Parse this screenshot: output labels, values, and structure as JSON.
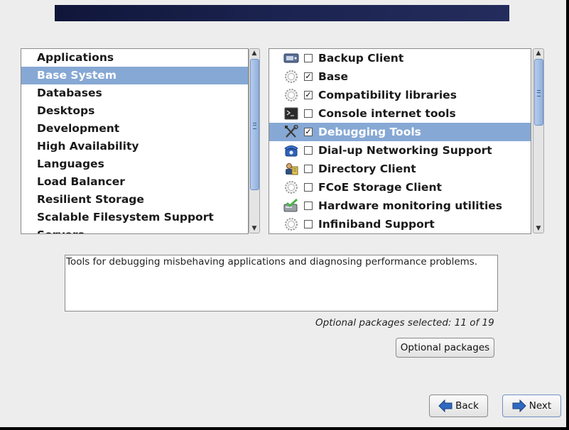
{
  "colors": {
    "banner": "#1b2450",
    "selection": "#86a8d4",
    "page_background": "#ededed"
  },
  "group_list": {
    "items": [
      {
        "label": "Applications",
        "selected": false
      },
      {
        "label": "Base System",
        "selected": true
      },
      {
        "label": "Databases",
        "selected": false
      },
      {
        "label": "Desktops",
        "selected": false
      },
      {
        "label": "Development",
        "selected": false
      },
      {
        "label": "High Availability",
        "selected": false
      },
      {
        "label": "Languages",
        "selected": false
      },
      {
        "label": "Load Balancer",
        "selected": false
      },
      {
        "label": "Resilient Storage",
        "selected": false
      },
      {
        "label": "Scalable Filesystem Support",
        "selected": false
      },
      {
        "label": "Servers",
        "selected": false
      }
    ]
  },
  "package_list": {
    "items": [
      {
        "label": "Backup Client",
        "checked": false,
        "selected": false,
        "icon": "backup-drive-icon"
      },
      {
        "label": "Base",
        "checked": true,
        "selected": false,
        "icon": "gear-icon"
      },
      {
        "label": "Compatibility libraries",
        "checked": true,
        "selected": false,
        "icon": "gear-icon"
      },
      {
        "label": "Console internet tools",
        "checked": false,
        "selected": false,
        "icon": "terminal-icon"
      },
      {
        "label": "Debugging Tools",
        "checked": true,
        "selected": true,
        "icon": "wrench-screwdriver-icon"
      },
      {
        "label": "Dial-up Networking Support",
        "checked": false,
        "selected": false,
        "icon": "telephone-icon"
      },
      {
        "label": "Directory Client",
        "checked": false,
        "selected": false,
        "icon": "directory-users-icon"
      },
      {
        "label": "FCoE Storage Client",
        "checked": false,
        "selected": false,
        "icon": "gear-icon"
      },
      {
        "label": "Hardware monitoring utilities",
        "checked": false,
        "selected": false,
        "icon": "hardware-check-icon"
      },
      {
        "label": "Infiniband Support",
        "checked": false,
        "selected": false,
        "icon": "gear-icon"
      }
    ]
  },
  "description": "Tools for debugging misbehaving applications and diagnosing performance problems.",
  "optional_status": "Optional packages selected: 11 of 19",
  "buttons": {
    "optional_packages": "Optional packages",
    "back": "Back",
    "next": "Next"
  }
}
